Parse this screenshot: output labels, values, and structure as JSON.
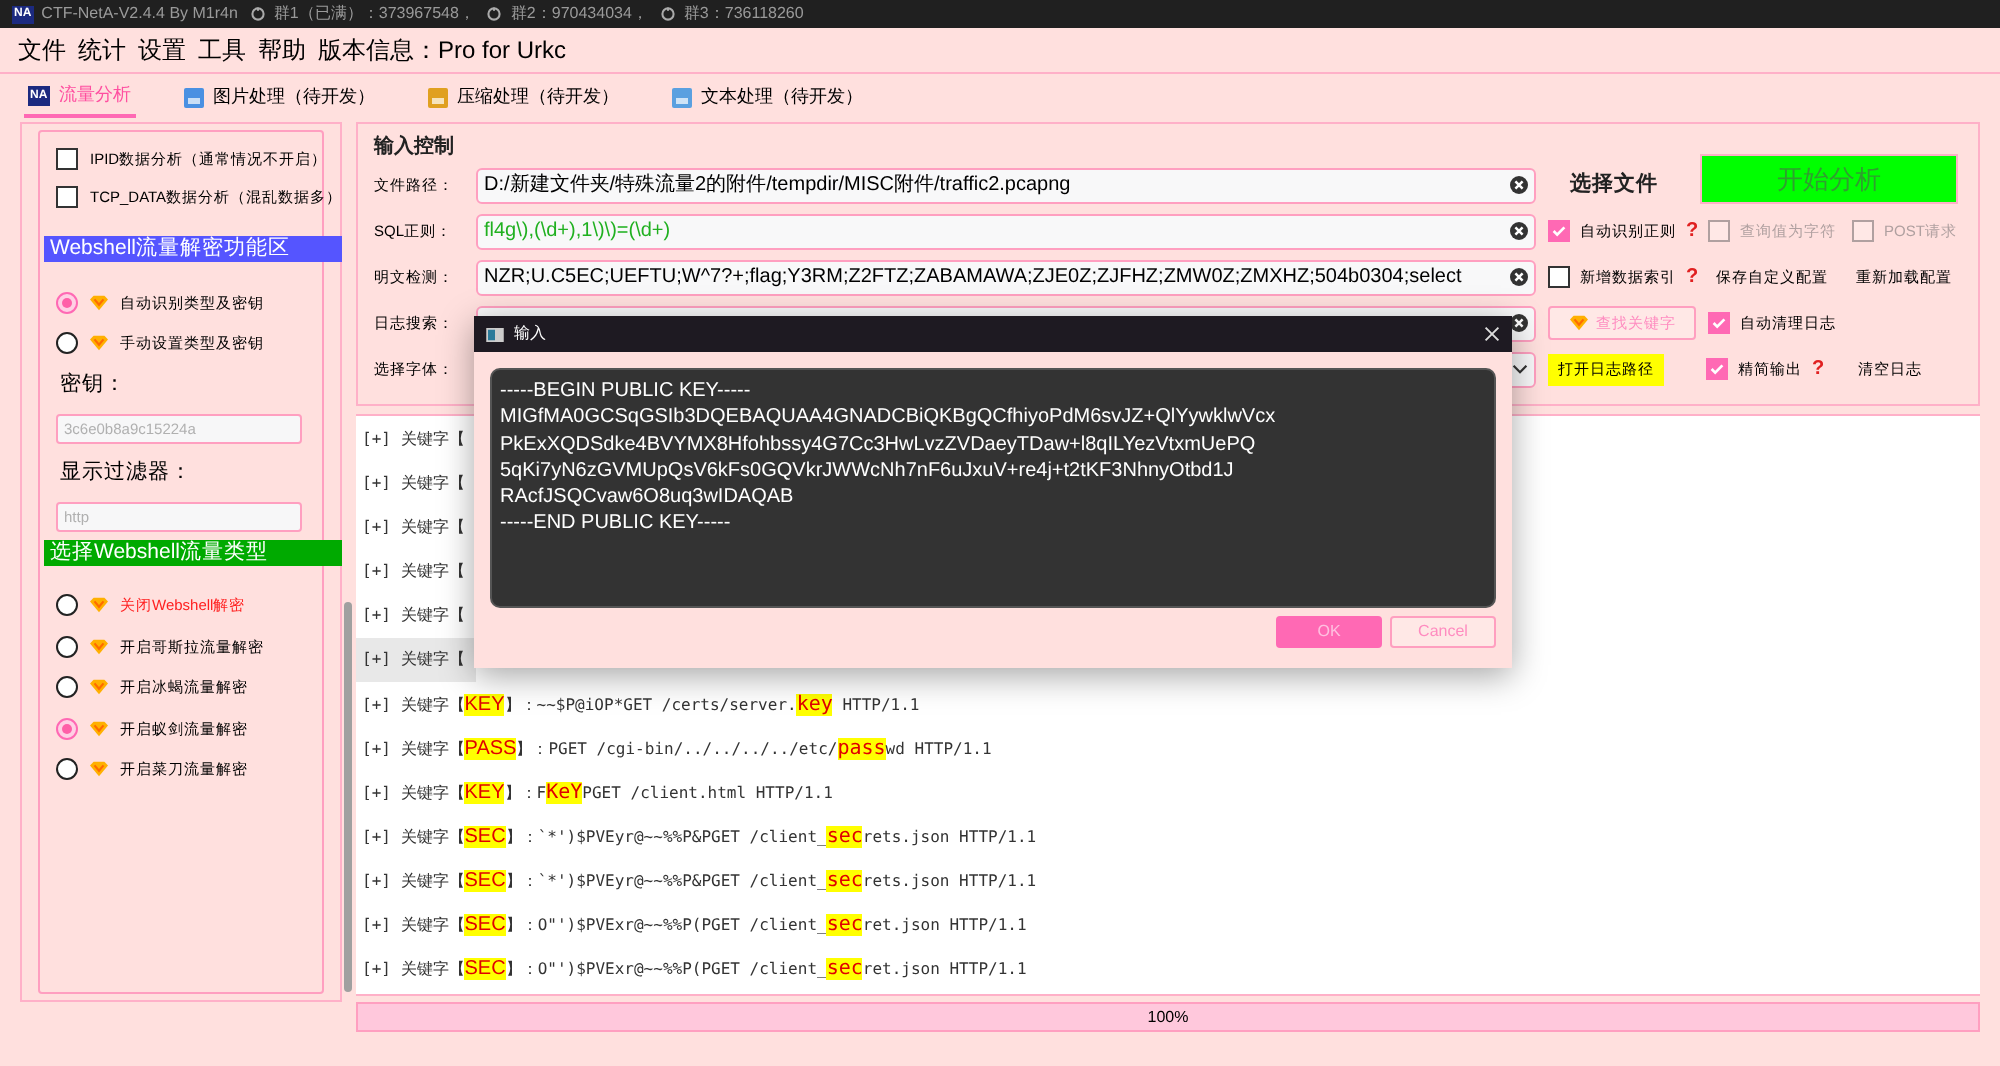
{
  "window": {
    "logo": "NA",
    "title": "CTF-NetA-V2.4.4 By M1r4n",
    "groups": [
      "群1（已满）：373967548，",
      "群2：970434034，",
      "群3：736118260"
    ]
  },
  "menu": [
    "文件",
    "统计",
    "设置",
    "工具",
    "帮助",
    "版本信息：Pro for Urkc"
  ],
  "tabs": [
    {
      "label": "流量分析",
      "icon_text": "NA",
      "selected": true
    },
    {
      "label": "图片处理（待开发）",
      "selected": false
    },
    {
      "label": "压缩处理（待开发）",
      "selected": false
    },
    {
      "label": "文本处理（待开发）",
      "selected": false
    }
  ],
  "sidebar": {
    "items": [
      {
        "kind": "checkbox",
        "label": "IPID数据分析（通常情况不开启）",
        "checked": false
      },
      {
        "kind": "checkbox",
        "label": "TCP_DATA数据分析（混乱数据多）",
        "checked": false
      },
      {
        "kind": "header",
        "label": "Webshell流量解密功能区",
        "color": "#5555ff"
      },
      {
        "kind": "radio",
        "label": "自动识别类型及密钥",
        "selected": true
      },
      {
        "kind": "radio",
        "label": "手动设置类型及密钥",
        "selected": false
      },
      {
        "kind": "label",
        "label": "密钥："
      },
      {
        "kind": "field",
        "placeholder": "3c6e0b8a9c15224a"
      },
      {
        "kind": "label",
        "label": "显示过滤器："
      },
      {
        "kind": "field",
        "placeholder": "http"
      },
      {
        "kind": "header",
        "label": "选择Webshell流量类型",
        "color": "#00aa00"
      },
      {
        "kind": "radio",
        "label": "关闭Webshell解密",
        "selected": false,
        "color": "#ff2020"
      },
      {
        "kind": "radio",
        "label": "开启哥斯拉流量解密",
        "selected": false
      },
      {
        "kind": "radio",
        "label": "开启冰蝎流量解密",
        "selected": false
      },
      {
        "kind": "radio",
        "label": "开启蚁剑流量解密",
        "selected": true
      },
      {
        "kind": "radio",
        "label": "开启菜刀流量解密",
        "selected": false
      }
    ]
  },
  "input_control": {
    "title": "输入控制",
    "file_path": {
      "label": "文件路径：",
      "value": "D:/新建文件夹/特殊流量2的附件/tempdir/MISC附件/traffic2.pcapng"
    },
    "select_file": "选择文件",
    "start": "开始分析",
    "sql_regex": {
      "label": "SQL正则：",
      "value": "fl4g\\),(\\d+),1\\)\\)=(\\d+)"
    },
    "auto_regex": {
      "label": "自动识别正则",
      "checked": true
    },
    "query_as_char": {
      "label": "查询值为字符",
      "checked": false,
      "disabled": true
    },
    "post_request": {
      "label": "POST请求",
      "checked": false,
      "disabled": true
    },
    "plaintext": {
      "label": "明文检测：",
      "value": "NZR;U.C5EC;UEFTU;W^7?+;flag;Y3RM;Z2FTZ;ZABAMAWA;ZJE0Z;ZJFHZ;ZMW0Z;ZMXHZ;504b0304;select"
    },
    "add_index": {
      "label": "新增数据索引",
      "checked": false
    },
    "save_config": "保存自定义配置",
    "reload_config": "重新加载配置",
    "log_search": {
      "label": "日志搜索："
    },
    "find_keyword": "查找关键字",
    "auto_clear": {
      "label": "自动清理日志",
      "checked": true
    },
    "font": {
      "label": "选择字体："
    },
    "open_log": "打开日志路径",
    "compact": {
      "label": "精简输出",
      "checked": true
    },
    "clear_log": "清空日志",
    "help": "?"
  },
  "log": [
    {
      "prefix": "[+] 关键字【",
      "selected": false
    },
    {
      "prefix": "[+] 关键字【",
      "selected": false
    },
    {
      "prefix": "[+] 关键字【",
      "selected": false
    },
    {
      "prefix": "[+] 关键字【",
      "selected": false
    },
    {
      "prefix": "[+] 关键字【",
      "selected": false
    },
    {
      "prefix": "[+] 关键字【",
      "selected": true
    },
    {
      "prefix": "[+] 关键字【",
      "keyword": "KEY",
      "suffix": "】：~~$P@iOP*GET /certs/server.",
      "match": "key",
      "after": " HTTP/1.1",
      "selected": false
    },
    {
      "prefix": "[+] 关键字【",
      "keyword": "PASS",
      "suffix": "】：PGET /cgi-bin/../../../../etc/",
      "match": "pass",
      "after": "wd HTTP/1.1",
      "selected": false
    },
    {
      "prefix": "[+] 关键字【",
      "keyword": "KEY",
      "suffix": "】：F",
      "match": "KeY",
      "after": "PGET /client.html HTTP/1.1",
      "selected": false
    },
    {
      "prefix": "[+] 关键字【",
      "keyword": "SEC",
      "suffix": "】：`*')$PVEyr@~~%%P&PGET /client_",
      "match": "sec",
      "after": "rets.json HTTP/1.1",
      "selected": false
    },
    {
      "prefix": "[+] 关键字【",
      "keyword": "SEC",
      "suffix": "】：`*')$PVEyr@~~%%P&PGET /client_",
      "match": "sec",
      "after": "rets.json HTTP/1.1",
      "selected": false
    },
    {
      "prefix": "[+] 关键字【",
      "keyword": "SEC",
      "suffix": "】：O\"')$PVExr@~~%%P(PGET /client_",
      "match": "sec",
      "after": "ret.json HTTP/1.1",
      "selected": false
    },
    {
      "prefix": "[+] 关键字【",
      "keyword": "SEC",
      "suffix": "】：O\"')$PVExr@~~%%P(PGET /client_",
      "match": "sec",
      "after": "ret.json HTTP/1.1",
      "selected": false
    }
  ],
  "progress": {
    "level": 1,
    "reading": "100%"
  },
  "dialog": {
    "title": "输入",
    "value": "-----BEGIN PUBLIC KEY-----\nMIGfMA0GCSqGSIb3DQEBAQUAA4GNADCBiQKBgQCfhiyoPdM6svJZ+QlYywklwVcx\nPkExXQDSdke4BVYMX8Hfohbssy4G7Cc3HwLvzZVDaeyTDaw+l8qILYezVtxmUePQ\n5qKi7yN6zGVMUpQsV6kFs0GQVkrJWWcNh7nF6uJxuV+re4j+t2tKF3NhnyOtbd1J\nRAcfJSQCvaw6O8uq3wIDAQAB\n-----END PUBLIC KEY-----",
    "ok": "OK",
    "cancel": "Cancel"
  }
}
